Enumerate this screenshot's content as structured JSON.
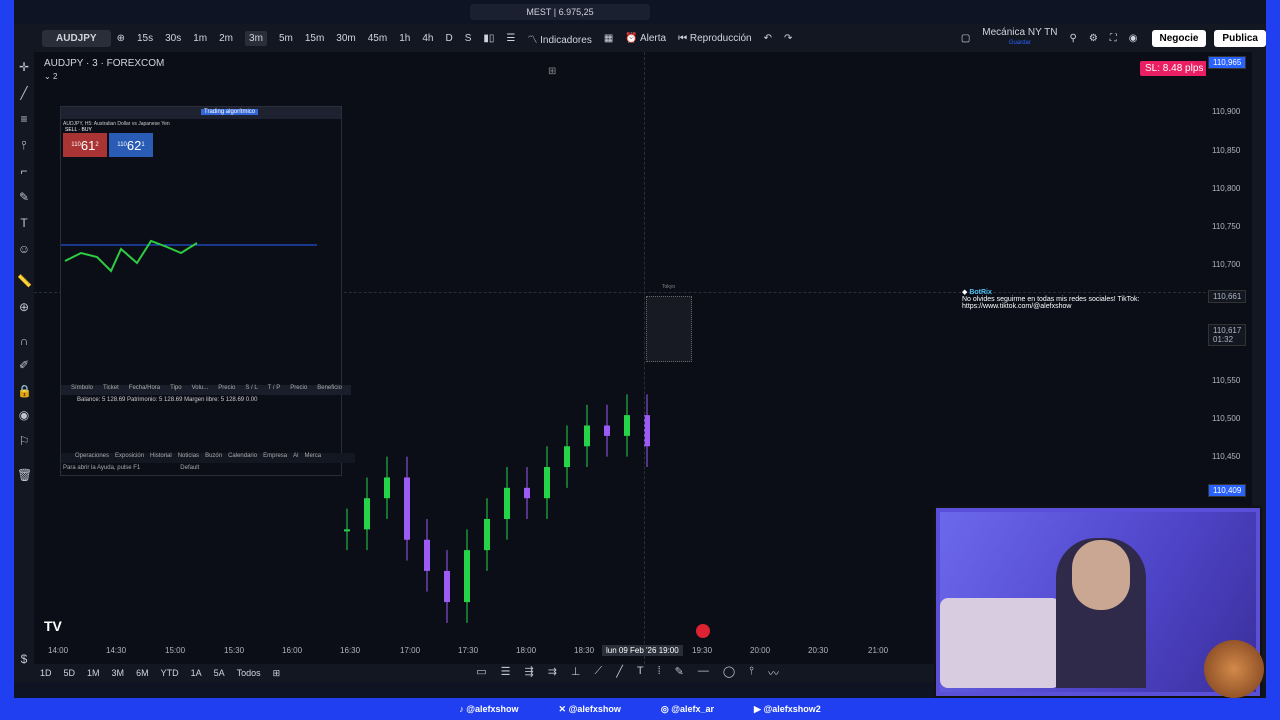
{
  "window": {
    "tab_title": "MEST | 6.975,25"
  },
  "toolbar": {
    "symbol": "AUDJPY",
    "intervals": [
      "15s",
      "30s",
      "1m",
      "2m",
      "3m",
      "5m",
      "15m",
      "30m",
      "45m",
      "1h",
      "4h",
      "D",
      "S"
    ],
    "selected_interval": "3m",
    "indicators": "Indicadores",
    "alert": "Alerta",
    "replay": "Reproducción",
    "layout_name": "Mecánica NY TN",
    "layout_sub": "Guardar",
    "trade_button": "Negocie",
    "publish_button": "Publica"
  },
  "legend": {
    "symbol_title": "AUDJPY · 3 · FOREXCOM",
    "counter": "2"
  },
  "sl_badge": "SL: 8.48 plps",
  "price_scale": {
    "top_box": "110,965",
    "labels": [
      "110,900",
      "110,850",
      "110,800",
      "110,750",
      "110,700",
      "110,550",
      "110,500",
      "110,450"
    ],
    "current_box": "110,661",
    "price_box": "110,617",
    "price_box_time": "01:32",
    "low_box": "110,409"
  },
  "time_axis": {
    "labels": [
      "14:00",
      "14:30",
      "15:00",
      "15:30",
      "16:00",
      "16:30",
      "17:00",
      "17:30",
      "18:00",
      "18:30",
      "19:30",
      "20:00",
      "20:30",
      "21:00"
    ],
    "highlight": "lun 09 Feb '26",
    "highlight_time": "19:00"
  },
  "bottom_ranges": [
    "1D",
    "5D",
    "1M",
    "3M",
    "6M",
    "YTD",
    "1A",
    "5A",
    "Todos"
  ],
  "mt_panel": {
    "title_button": "Trading algorítmico",
    "symbol_line": "AUDJPY, H5: Australian Dollar vs Japanese Yen",
    "sell_label": "SELL",
    "buy_label": "BUY",
    "sell_price_prefix": "110",
    "sell_price": "61",
    "sell_sup": "2",
    "buy_price_prefix": "110",
    "buy_price": "62",
    "buy_sup": "1",
    "columns": [
      "Símbolo",
      "Ticket",
      "Fecha/Hora",
      "Tipo",
      "Volu...",
      "Precio",
      "S / L",
      "T / P",
      "Precio",
      "Beneficio"
    ],
    "balance": "Balance: 5 128.69  Patrimonio: 5 128.69  Margen libre: 5 128.69",
    "balance_value": "0.00",
    "tabs": [
      "Operaciones",
      "Exposición",
      "Historial",
      "Noticias",
      "Buzón",
      "Calendario",
      "Empresa",
      "Al",
      "Merca"
    ],
    "status_left": "Para abrir la Ayuda, pulse F1",
    "status_right": "Default"
  },
  "botrix": {
    "name": "BotRix",
    "message": "No olvides seguirme en todas mis redes sociales! TikTok: https://www.tiktok.com/@alefxshow"
  },
  "tokyo_label": "Tokyo",
  "social": [
    {
      "icon": "tiktok-icon",
      "handle": "@alefxshow"
    },
    {
      "icon": "x-icon",
      "handle": "@alefxshow"
    },
    {
      "icon": "instagram-icon",
      "handle": "@alefx_ar"
    },
    {
      "icon": "youtube-icon",
      "handle": "@alefxshow2"
    }
  ],
  "chart_data": {
    "type": "candlestick",
    "series": [
      {
        "name": "AUDJPY",
        "values": [
          110.52,
          110.55,
          110.57,
          110.51,
          110.48,
          110.45,
          110.5,
          110.53,
          110.56,
          110.55,
          110.58,
          110.6,
          110.62,
          110.61,
          110.63,
          110.6
        ]
      }
    ],
    "ylim": [
      110.4,
      110.97
    ]
  }
}
